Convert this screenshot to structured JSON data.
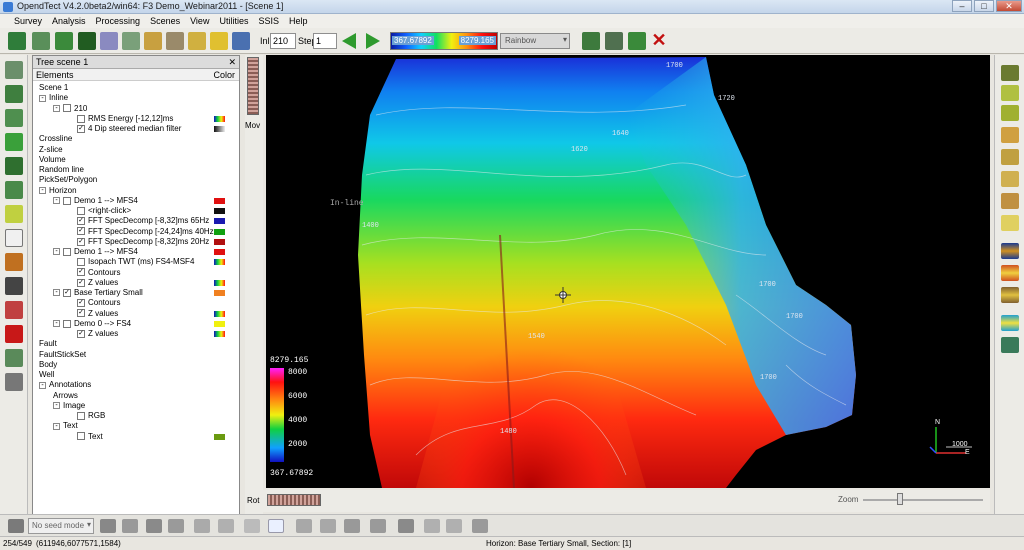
{
  "window": {
    "title": "OpendTect V4.2.0beta2/win64: F3 Demo_Webinar2011 - [Scene 1]",
    "buttons": [
      "–",
      "□",
      "✕"
    ]
  },
  "menu": [
    "Survey",
    "Analysis",
    "Processing",
    "Scenes",
    "View",
    "Utilities",
    "SSIS",
    "Help"
  ],
  "toolbar": {
    "inl_label": "Inl",
    "inl_value": "210",
    "step_label": "Step",
    "step_value": "1",
    "colorbar_min": "367.67892",
    "colorbar_max": "8279.165",
    "colormap": "Rainbow"
  },
  "tree": {
    "panel_title": "Tree scene 1",
    "col_elements": "Elements",
    "col_color": "Color",
    "items": [
      {
        "label": "Scene 1",
        "indent": 0,
        "exp": "",
        "cb": "none"
      },
      {
        "label": "Inline",
        "indent": 0,
        "exp": "-",
        "cb": "none"
      },
      {
        "label": "210",
        "indent": 1,
        "exp": "-",
        "cb": "empty"
      },
      {
        "label": "RMS Energy [-12,12]ms",
        "indent": 2,
        "exp": "",
        "cb": "empty",
        "swatch": "rainbow"
      },
      {
        "label": "4 Dip steered median filter",
        "indent": 2,
        "exp": "",
        "cb": "checked",
        "swatch": "gray"
      },
      {
        "label": "Crossline",
        "indent": 0,
        "exp": "",
        "cb": "none"
      },
      {
        "label": "Z-slice",
        "indent": 0,
        "exp": "",
        "cb": "none"
      },
      {
        "label": "Volume",
        "indent": 0,
        "exp": "",
        "cb": "none"
      },
      {
        "label": "Random line",
        "indent": 0,
        "exp": "",
        "cb": "none"
      },
      {
        "label": "PickSet/Polygon",
        "indent": 0,
        "exp": "",
        "cb": "none"
      },
      {
        "label": "Horizon",
        "indent": 0,
        "exp": "-",
        "cb": "none"
      },
      {
        "label": "Demo 1 --> MFS4",
        "indent": 1,
        "exp": "-",
        "cb": "empty",
        "swatch": "#e01010"
      },
      {
        "label": "<right-click>",
        "indent": 2,
        "exp": "",
        "cb": "empty",
        "swatch": "#111111"
      },
      {
        "label": "FFT SpecDecomp [-8,32]ms 65Hz",
        "indent": 2,
        "exp": "",
        "cb": "checked",
        "swatch": "#1a1ab0"
      },
      {
        "label": "FFT SpecDecomp [-24,24]ms 40Hz",
        "indent": 2,
        "exp": "",
        "cb": "checked",
        "swatch": "#10a010"
      },
      {
        "label": "FFT SpecDecomp [-8,32]ms 20Hz",
        "indent": 2,
        "exp": "",
        "cb": "checked",
        "swatch": "#b01010"
      },
      {
        "label": "Demo 1 --> MFS4",
        "indent": 1,
        "exp": "-",
        "cb": "empty",
        "swatch": "#e01010"
      },
      {
        "label": "Isopach TWT (ms) FS4-MSF4",
        "indent": 2,
        "exp": "",
        "cb": "empty",
        "swatch": "rainbow"
      },
      {
        "label": "Contours",
        "indent": 2,
        "exp": "",
        "cb": "checked",
        "swatch": ""
      },
      {
        "label": "Z values",
        "indent": 2,
        "exp": "",
        "cb": "checked",
        "swatch": "rainbow"
      },
      {
        "label": "Base Tertiary Small",
        "indent": 1,
        "exp": "-",
        "cb": "checked",
        "swatch": "#f08020"
      },
      {
        "label": "Contours",
        "indent": 2,
        "exp": "",
        "cb": "checked",
        "swatch": ""
      },
      {
        "label": "Z values",
        "indent": 2,
        "exp": "",
        "cb": "checked",
        "swatch": "rainbow"
      },
      {
        "label": "Demo 0 --> FS4",
        "indent": 1,
        "exp": "-",
        "cb": "empty",
        "swatch": "#f0f010"
      },
      {
        "label": "Z values",
        "indent": 2,
        "exp": "",
        "cb": "checked",
        "swatch": "rainbow"
      },
      {
        "label": "Fault",
        "indent": 0,
        "exp": "",
        "cb": "none"
      },
      {
        "label": "FaultStickSet",
        "indent": 0,
        "exp": "",
        "cb": "none"
      },
      {
        "label": "Body",
        "indent": 0,
        "exp": "",
        "cb": "none"
      },
      {
        "label": "Well",
        "indent": 0,
        "exp": "",
        "cb": "none"
      },
      {
        "label": "Annotations",
        "indent": 0,
        "exp": "-",
        "cb": "none"
      },
      {
        "label": "Arrows",
        "indent": 1,
        "exp": "",
        "cb": "none"
      },
      {
        "label": "Image",
        "indent": 1,
        "exp": "-",
        "cb": "none"
      },
      {
        "label": "RGB",
        "indent": 2,
        "exp": "",
        "cb": "empty",
        "swatch": ""
      },
      {
        "label": "Text",
        "indent": 1,
        "exp": "-",
        "cb": "none"
      },
      {
        "label": "Text",
        "indent": 2,
        "exp": "",
        "cb": "empty",
        "swatch": "#6a9a10"
      }
    ]
  },
  "scene": {
    "mov_label": "Mov",
    "rot_label": "Rot",
    "zoom_label": "Zoom",
    "inline_label": "In-line",
    "contour_labels": [
      "1700",
      "1720",
      "1640",
      "1620",
      "1700",
      "1540",
      "1480",
      "1400",
      "1700",
      "1700"
    ],
    "legend": {
      "max": "8279.165",
      "min": "367.67892",
      "ticks": [
        "8000",
        "6000",
        "4000",
        "2000"
      ]
    },
    "axes": {
      "n": "N",
      "e": "E",
      "scale": "1000"
    }
  },
  "bottom_toolbar": {
    "seed_mode": "No seed mode"
  },
  "status": {
    "frame": "254/549",
    "coords": "(611946,6077571,1584)",
    "info": "Horizon: Base Tertiary Small, Section: [1]"
  }
}
